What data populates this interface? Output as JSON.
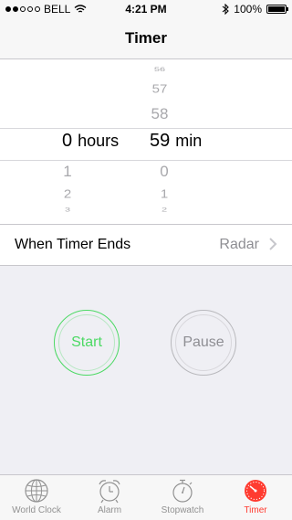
{
  "status": {
    "carrier": "BELL",
    "time": "4:21 PM",
    "battery": "100%",
    "battery_level": 1.0
  },
  "nav": {
    "title": "Timer"
  },
  "picker": {
    "hours_above": [],
    "hours_selected": "0",
    "hours_unit": "hours",
    "hours_below": [
      "1",
      "2",
      "3"
    ],
    "minutes_above": [
      "56",
      "57",
      "58"
    ],
    "minutes_selected": "59",
    "minutes_unit": "min",
    "minutes_below": [
      "0",
      "1",
      "2"
    ]
  },
  "when_timer_ends": {
    "label": "When Timer Ends",
    "value": "Radar"
  },
  "buttons": {
    "start": "Start",
    "pause": "Pause"
  },
  "tabs": [
    {
      "label": "World Clock",
      "icon": "globe-icon"
    },
    {
      "label": "Alarm",
      "icon": "alarm-clock-icon"
    },
    {
      "label": "Stopwatch",
      "icon": "stopwatch-icon"
    },
    {
      "label": "Timer",
      "icon": "timer-icon",
      "active": true
    }
  ],
  "colors": {
    "start_green": "#4cd964",
    "active_red": "#ff3b30",
    "inactive_gray": "#929292"
  }
}
